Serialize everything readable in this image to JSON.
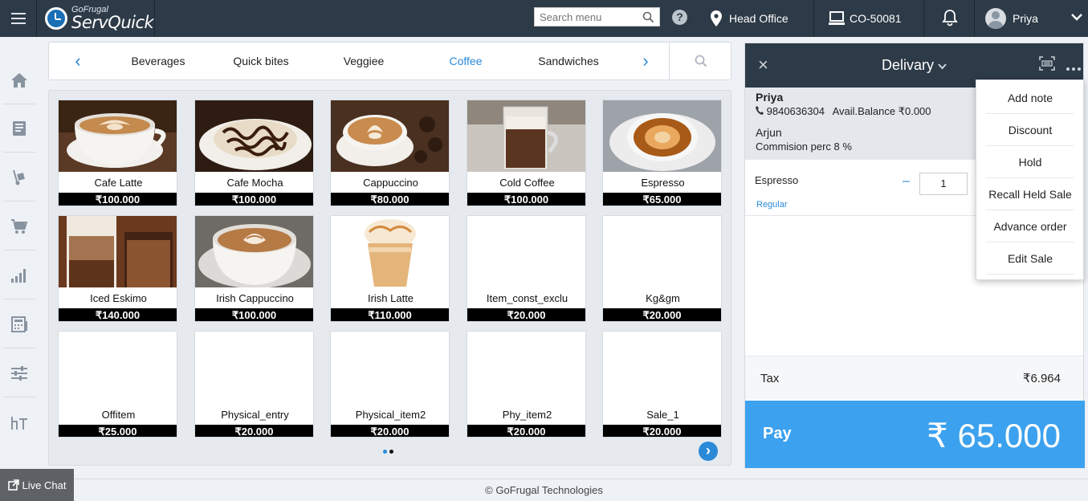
{
  "app": {
    "logo_small": "GoFrugal",
    "logo_big": "ServQuick"
  },
  "topbar": {
    "search_placeholder": "Search menu",
    "help_icon": "?",
    "location": "Head Office",
    "terminal": "CO-50081",
    "user": "Priya"
  },
  "categories": {
    "tabs": [
      "Beverages",
      "Quick bites",
      "Veggiee",
      "Coffee",
      "Sandwiches"
    ],
    "active": "Coffee",
    "prev_arrow": "‹",
    "next_arrow": "›"
  },
  "items": [
    {
      "name": "Cafe Latte",
      "price": "₹100.000",
      "image": "cafe-latte"
    },
    {
      "name": "Cafe Mocha",
      "price": "₹100.000",
      "image": "cafe-mocha"
    },
    {
      "name": "Cappuccino",
      "price": "₹80.000",
      "image": "cappuccino"
    },
    {
      "name": "Cold Coffee",
      "price": "₹100.000",
      "image": "cold-coffee"
    },
    {
      "name": "Espresso",
      "price": "₹65.000",
      "image": "espresso"
    },
    {
      "name": "Iced Eskimo",
      "price": "₹140.000",
      "image": "iced-eskimo"
    },
    {
      "name": "Irish Cappuccino",
      "price": "₹100.000",
      "image": "irish-cappuccino"
    },
    {
      "name": "Irish Latte",
      "price": "₹110.000",
      "image": "irish-latte"
    },
    {
      "name": "Item_const_exclu",
      "price": "₹20.000",
      "image": ""
    },
    {
      "name": "Kg&gm",
      "price": "₹20.000",
      "image": ""
    },
    {
      "name": "Offitem",
      "price": "₹25.000",
      "image": ""
    },
    {
      "name": "Physical_entry",
      "price": "₹20.000",
      "image": ""
    },
    {
      "name": "Physical_item2",
      "price": "₹20.000",
      "image": ""
    },
    {
      "name": "Phy_item2",
      "price": "₹20.000",
      "image": ""
    },
    {
      "name": "Sale_1",
      "price": "₹20.000",
      "image": ""
    }
  ],
  "pager": {
    "next": "›"
  },
  "order": {
    "close": "×",
    "type": "Delivary",
    "customer_name": "Priya",
    "customer_phone": "9840636304",
    "customer_balance": "Avail.Balance ₹0.000",
    "salesperson": "Arjun",
    "commission": "Commision perc 8 %",
    "line_item": {
      "name": "Espresso",
      "variant": "Regular",
      "qty_minus": "–",
      "qty": "1"
    },
    "tax_label": "Tax",
    "tax_value": "₹6.964",
    "pay_label": "Pay",
    "pay_amount": "₹ 65.000"
  },
  "menu": {
    "items": [
      "Add note",
      "Discount",
      "Hold",
      "Recall Held Sale",
      "Advance order",
      "Edit Sale"
    ]
  },
  "footer": {
    "copyright": "© GoFrugal Technologies",
    "live_chat": "Live Chat"
  },
  "colors": {
    "topbar": "#2d3a47",
    "accent": "#2a8ad8",
    "pay": "#3ca1ee"
  }
}
